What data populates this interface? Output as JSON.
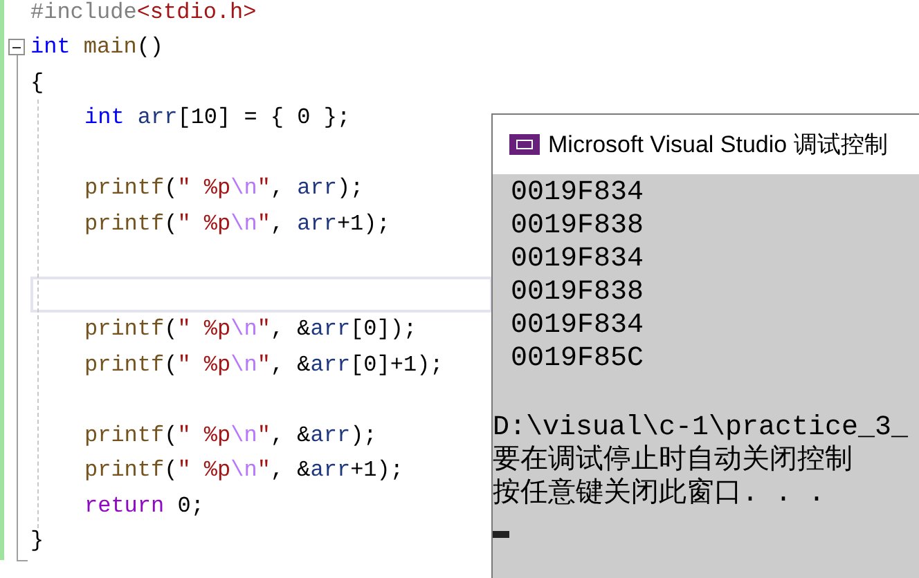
{
  "editor": {
    "lines": [
      {
        "kind": "code",
        "indented": false,
        "current": false,
        "tokens": [
          {
            "kind": "preproc",
            "text": "#include"
          },
          {
            "kind": "string",
            "text": "<stdio.h>"
          }
        ]
      },
      {
        "kind": "code",
        "indented": false,
        "current": false,
        "tokens": [
          {
            "kind": "keyword",
            "text": "int"
          },
          {
            "kind": "func",
            "text": " main"
          },
          {
            "kind": "plain",
            "text": "()"
          }
        ]
      },
      {
        "kind": "code",
        "indented": false,
        "current": false,
        "tokens": [
          {
            "kind": "plain",
            "text": "{"
          }
        ]
      },
      {
        "kind": "code",
        "indented": true,
        "current": false,
        "tokens": [
          {
            "kind": "keyword",
            "text": "int"
          },
          {
            "kind": "ident",
            "text": " arr"
          },
          {
            "kind": "plain",
            "text": "[10] = { 0 };"
          }
        ]
      },
      {
        "kind": "blank",
        "current": false
      },
      {
        "kind": "code",
        "indented": true,
        "current": false,
        "tokens": [
          {
            "kind": "func",
            "text": "printf"
          },
          {
            "kind": "plain",
            "text": "("
          },
          {
            "kind": "string",
            "text": "\" %p"
          },
          {
            "kind": "escape",
            "text": "\\n"
          },
          {
            "kind": "string",
            "text": "\""
          },
          {
            "kind": "plain",
            "text": ", "
          },
          {
            "kind": "ident",
            "text": "arr"
          },
          {
            "kind": "plain",
            "text": ");"
          }
        ]
      },
      {
        "kind": "code",
        "indented": true,
        "current": false,
        "tokens": [
          {
            "kind": "func",
            "text": "printf"
          },
          {
            "kind": "plain",
            "text": "("
          },
          {
            "kind": "string",
            "text": "\" %p"
          },
          {
            "kind": "escape",
            "text": "\\n"
          },
          {
            "kind": "string",
            "text": "\""
          },
          {
            "kind": "plain",
            "text": ", "
          },
          {
            "kind": "ident",
            "text": "arr"
          },
          {
            "kind": "plain",
            "text": "+1);"
          }
        ]
      },
      {
        "kind": "blank",
        "current": false
      },
      {
        "kind": "blank",
        "current": true
      },
      {
        "kind": "code",
        "indented": true,
        "current": false,
        "tokens": [
          {
            "kind": "func",
            "text": "printf"
          },
          {
            "kind": "plain",
            "text": "("
          },
          {
            "kind": "string",
            "text": "\" %p"
          },
          {
            "kind": "escape",
            "text": "\\n"
          },
          {
            "kind": "string",
            "text": "\""
          },
          {
            "kind": "plain",
            "text": ", &"
          },
          {
            "kind": "ident",
            "text": "arr"
          },
          {
            "kind": "plain",
            "text": "[0]);"
          }
        ]
      },
      {
        "kind": "code",
        "indented": true,
        "current": false,
        "tokens": [
          {
            "kind": "func",
            "text": "printf"
          },
          {
            "kind": "plain",
            "text": "("
          },
          {
            "kind": "string",
            "text": "\" %p"
          },
          {
            "kind": "escape",
            "text": "\\n"
          },
          {
            "kind": "string",
            "text": "\""
          },
          {
            "kind": "plain",
            "text": ", &"
          },
          {
            "kind": "ident",
            "text": "arr"
          },
          {
            "kind": "plain",
            "text": "[0]+1);"
          }
        ]
      },
      {
        "kind": "blank",
        "current": false
      },
      {
        "kind": "code",
        "indented": true,
        "current": false,
        "tokens": [
          {
            "kind": "func",
            "text": "printf"
          },
          {
            "kind": "plain",
            "text": "("
          },
          {
            "kind": "string",
            "text": "\" %p"
          },
          {
            "kind": "escape",
            "text": "\\n"
          },
          {
            "kind": "string",
            "text": "\""
          },
          {
            "kind": "plain",
            "text": ", &"
          },
          {
            "kind": "ident",
            "text": "arr"
          },
          {
            "kind": "plain",
            "text": ");"
          }
        ]
      },
      {
        "kind": "code",
        "indented": true,
        "current": false,
        "tokens": [
          {
            "kind": "func",
            "text": "printf"
          },
          {
            "kind": "plain",
            "text": "("
          },
          {
            "kind": "string",
            "text": "\" %p"
          },
          {
            "kind": "escape",
            "text": "\\n"
          },
          {
            "kind": "string",
            "text": "\""
          },
          {
            "kind": "plain",
            "text": ", &"
          },
          {
            "kind": "ident",
            "text": "arr"
          },
          {
            "kind": "plain",
            "text": "+1);"
          }
        ]
      },
      {
        "kind": "code",
        "indented": true,
        "current": false,
        "tokens": [
          {
            "kind": "control",
            "text": "return"
          },
          {
            "kind": "plain",
            "text": " 0;"
          }
        ]
      },
      {
        "kind": "code",
        "indented": false,
        "current": false,
        "tokens": [
          {
            "kind": "plain",
            "text": "}"
          }
        ]
      }
    ]
  },
  "console": {
    "title": "Microsoft Visual Studio 调试控制",
    "output": [
      "0019F834",
      "0019F838",
      "0019F834",
      "0019F838",
      "0019F834",
      "0019F85C"
    ],
    "messages": [
      "D:\\visual\\c-1\\practice_3_",
      "要在调试停止时自动关闭控制",
      "按任意键关闭此窗口. . ."
    ]
  }
}
